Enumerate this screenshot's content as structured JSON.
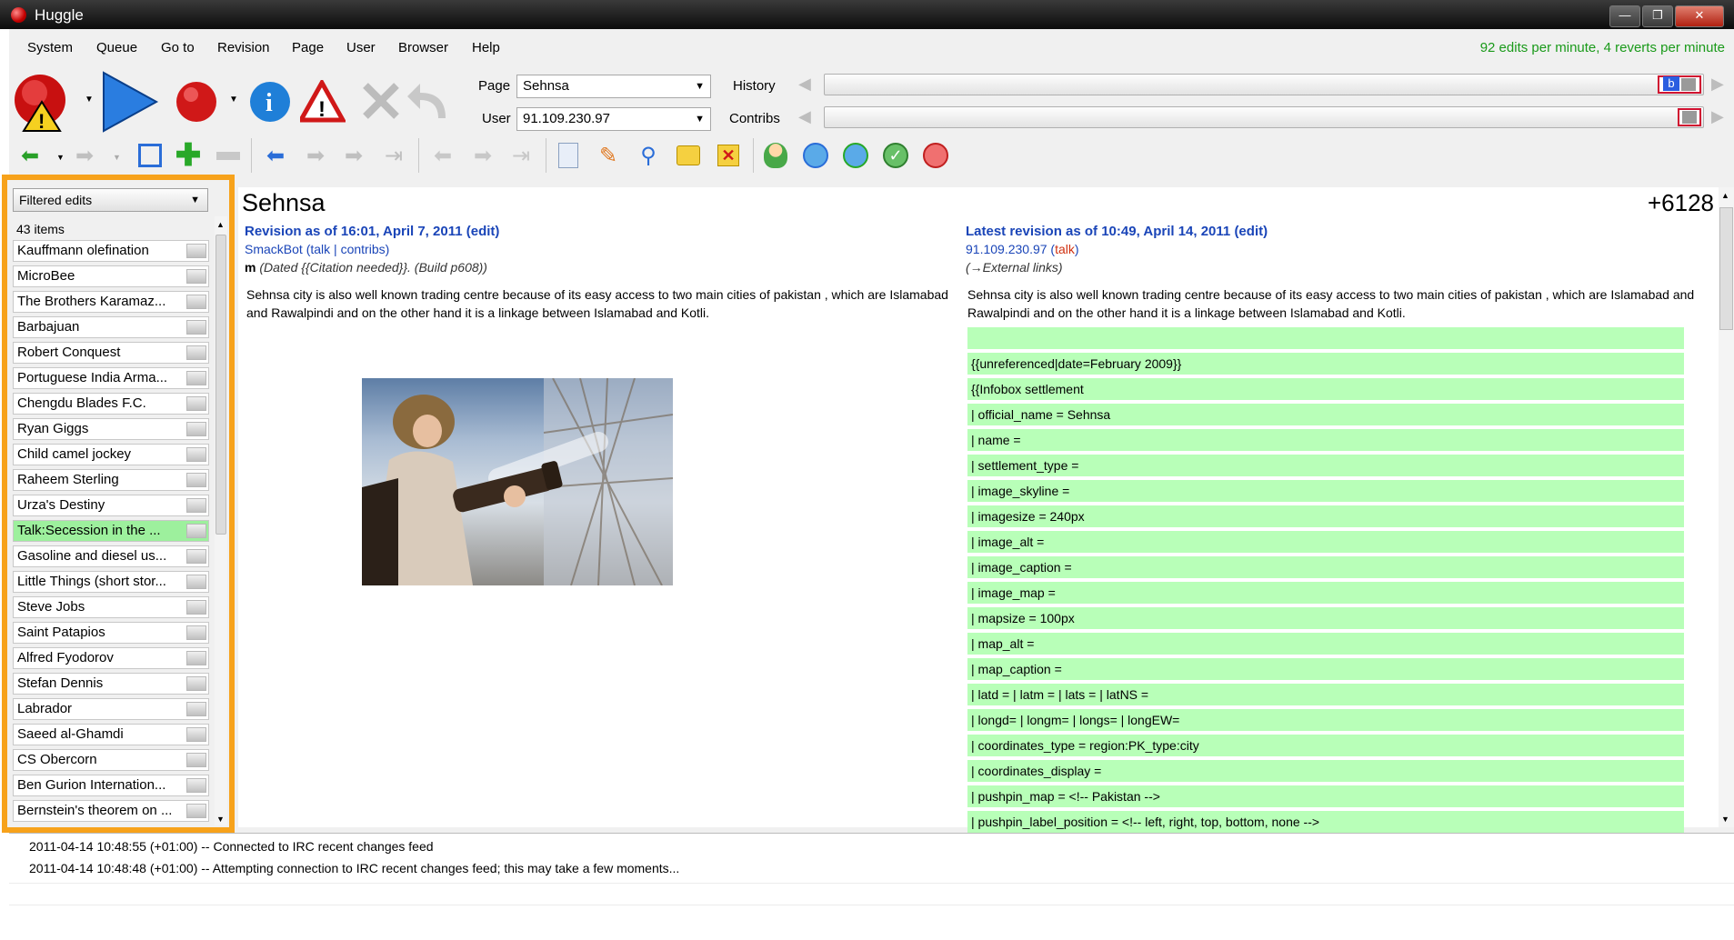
{
  "window": {
    "title": "Huggle"
  },
  "menu": {
    "items": [
      "System",
      "Queue",
      "Go to",
      "Revision",
      "Page",
      "User",
      "Browser",
      "Help"
    ]
  },
  "status": {
    "rate": "92 edits per minute, 4 reverts per minute"
  },
  "toolbar": {
    "page_label": "Page",
    "page_value": "Sehnsa",
    "user_label": "User",
    "user_value": "91.109.230.97",
    "history_label": "History",
    "contribs_label": "Contribs",
    "history_marker": "b"
  },
  "queue": {
    "filter": "Filtered edits",
    "count": "43 items",
    "items": [
      {
        "label": "Kauffmann olefination"
      },
      {
        "label": "MicroBee"
      },
      {
        "label": "The Brothers Karamaz..."
      },
      {
        "label": "Barbajuan"
      },
      {
        "label": "Robert Conquest"
      },
      {
        "label": "Portuguese India Arma..."
      },
      {
        "label": "Chengdu Blades F.C."
      },
      {
        "label": "Ryan Giggs"
      },
      {
        "label": "Child camel jockey"
      },
      {
        "label": "Raheem Sterling"
      },
      {
        "label": "Urza's Destiny"
      },
      {
        "label": "Talk:Secession in the ..."
      },
      {
        "label": "Gasoline and diesel us..."
      },
      {
        "label": "Little Things (short stor..."
      },
      {
        "label": "Steve Jobs"
      },
      {
        "label": "Saint Patapios"
      },
      {
        "label": "Alfred Fyodorov"
      },
      {
        "label": "Stefan Dennis"
      },
      {
        "label": "Labrador"
      },
      {
        "label": "Saeed al-Ghamdi"
      },
      {
        "label": "CS Obercorn"
      },
      {
        "label": "Ben Gurion Internation..."
      },
      {
        "label": "Bernstein's theorem on ..."
      }
    ]
  },
  "diff": {
    "page_title": "Sehnsa",
    "delta": "+6128",
    "left": {
      "heading": "Revision as of 16:01, April 7, 2011",
      "edit": "(edit)",
      "user": "SmackBot",
      "talk": "talk",
      "contribs": "contribs",
      "minor": "m",
      "summary": "(Dated {{Citation needed}}. (Build p608))",
      "text": "Sehnsa city is also well known trading centre because of its easy access to two main cities of pakistan , which are Islamabad and Rawalpindi and on the other hand it is a linkage between Islamabad and Kotli."
    },
    "right": {
      "heading": "Latest revision as of 10:49, April 14, 2011",
      "edit": "(edit)",
      "user": "91.109.230.97",
      "talk": "talk",
      "summary": "(→External links)",
      "text": "Sehnsa city is also well known trading centre because of its easy access to two main cities of pakistan , which are Islamabad and Rawalpindi and on the other hand it is a linkage between Islamabad and Kotli."
    },
    "added_lines": [
      "",
      "{{unreferenced|date=February 2009}}",
      "{{Infobox settlement",
      "| official_name = Sehnsa",
      "| name =",
      "| settlement_type =",
      "| image_skyline =",
      "| imagesize = 240px",
      "| image_alt =",
      "| image_caption =",
      "| image_map =",
      "| mapsize = 100px",
      "| map_alt =",
      "| map_caption =",
      "| latd = | latm = | lats = | latNS =",
      "| longd= | longm= | longs= | longEW=",
      "| coordinates_type = region:PK_type:city",
      "| coordinates_display =",
      "| pushpin_map = <!-- Pakistan -->",
      "| pushpin_label_position = <!-- left, right, top, bottom, none -->"
    ]
  },
  "log": {
    "lines": [
      "2011-04-14 10:48:55 (+01:00) -- Connected to IRC recent changes feed",
      "2011-04-14 10:48:48 (+01:00) -- Attempting connection to IRC recent changes feed; this may take a few moments..."
    ]
  },
  "colors": {
    "accent_highlight": "#f7a21b",
    "added_line": "#b8ffb8",
    "link": "#1a45b8",
    "rate_text": "#1a9a1a"
  }
}
